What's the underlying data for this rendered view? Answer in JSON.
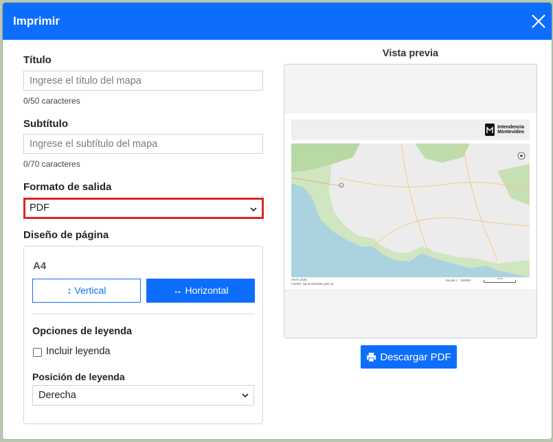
{
  "dialog": {
    "title": "Imprimir",
    "close_icon": "close-icon"
  },
  "form": {
    "title_label": "Título",
    "title_placeholder": "Ingrese el título del mapa",
    "title_counter": "0/50 caracteres",
    "subtitle_label": "Subtítulo",
    "subtitle_placeholder": "Ingrese el subtítulo del mapa",
    "subtitle_counter": "0/70 caracteres",
    "format_label": "Formato de salida",
    "format_value": "PDF",
    "layout_label": "Diseño de página",
    "paper_size": "A4",
    "orientation_vertical": "Vertical",
    "orientation_horizontal": "Horizontal",
    "orientation_selected": "Horizontal",
    "legend_options_label": "Opciones de leyenda",
    "include_legend_label": "Incluir leyenda",
    "include_legend_checked": false,
    "legend_position_label": "Posición de leyenda",
    "legend_position_value": "Derecha"
  },
  "preview": {
    "title": "Vista previa",
    "logo_line1": "Intendencia",
    "logo_line2": "Montevideo",
    "date": "29.07.2026",
    "source": "Fuente: sig.montevideo.gub.uy",
    "scale": "Escala 1 : 150000",
    "scalebar_label": "5 km"
  },
  "actions": {
    "download_label": "Descargar PDF",
    "download_icon": "printer-icon"
  },
  "colors": {
    "accent": "#0d6efd",
    "highlight_border": "#d9262b"
  }
}
